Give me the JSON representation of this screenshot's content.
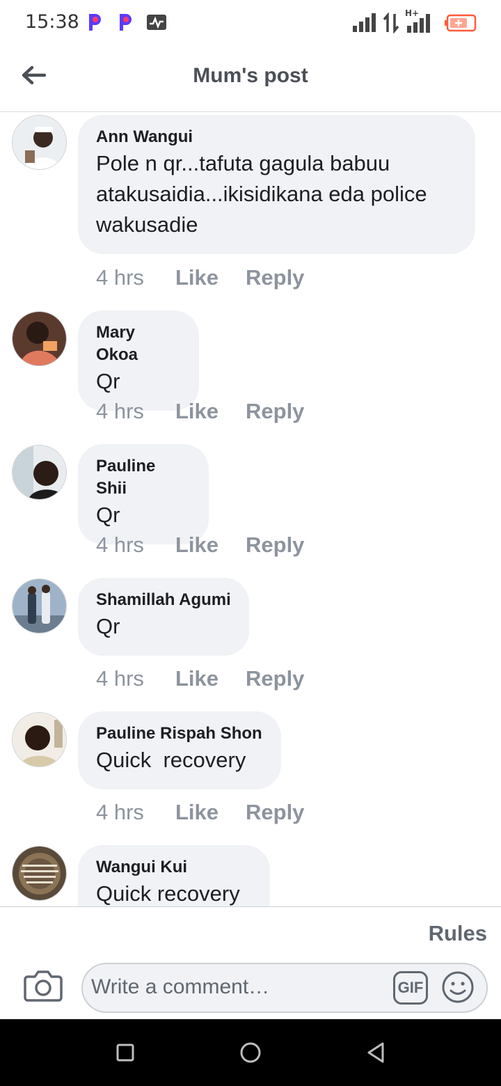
{
  "status_bar": {
    "time": "15:38",
    "network_type": "H+",
    "battery_color": "#ff5b3a",
    "icons": [
      "p-app-icon",
      "p-app-icon",
      "activity-monitor-icon",
      "signal-icon",
      "data-transfer-icon",
      "signal-icon",
      "battery-icon"
    ]
  },
  "header": {
    "title": "Mum's post",
    "back_icon": "back-arrow-icon"
  },
  "comments": [
    {
      "author": "Ann Wangui",
      "text": "Pole n qr...tafuta gagula babuu atakusaidia...ikisidikana eda police wakusadie",
      "time": "4 hrs",
      "like": "Like",
      "reply": "Reply"
    },
    {
      "author": "Mary Okoa",
      "text": "Qr",
      "time": "4 hrs",
      "like": "Like",
      "reply": "Reply"
    },
    {
      "author": "Pauline Shii",
      "text": "Qr",
      "time": "4 hrs",
      "like": "Like",
      "reply": "Reply"
    },
    {
      "author": "Shamillah Agumi",
      "text": "Qr",
      "time": "4 hrs",
      "like": "Like",
      "reply": "Reply"
    },
    {
      "author": "Pauline Rispah Shon",
      "text": "Quick  recovery",
      "time": "4 hrs",
      "like": "Like",
      "reply": "Reply"
    },
    {
      "author": "Wangui Kui",
      "text": "Quick recovery",
      "time": "",
      "like": "",
      "reply": ""
    }
  ],
  "composer": {
    "rules_label": "Rules",
    "placeholder": "Write a comment…",
    "gif_label": "GIF"
  },
  "colors": {
    "bubble": "#f0f2f5",
    "meta_text": "#8d949e",
    "header_title": "#4b4f56"
  }
}
